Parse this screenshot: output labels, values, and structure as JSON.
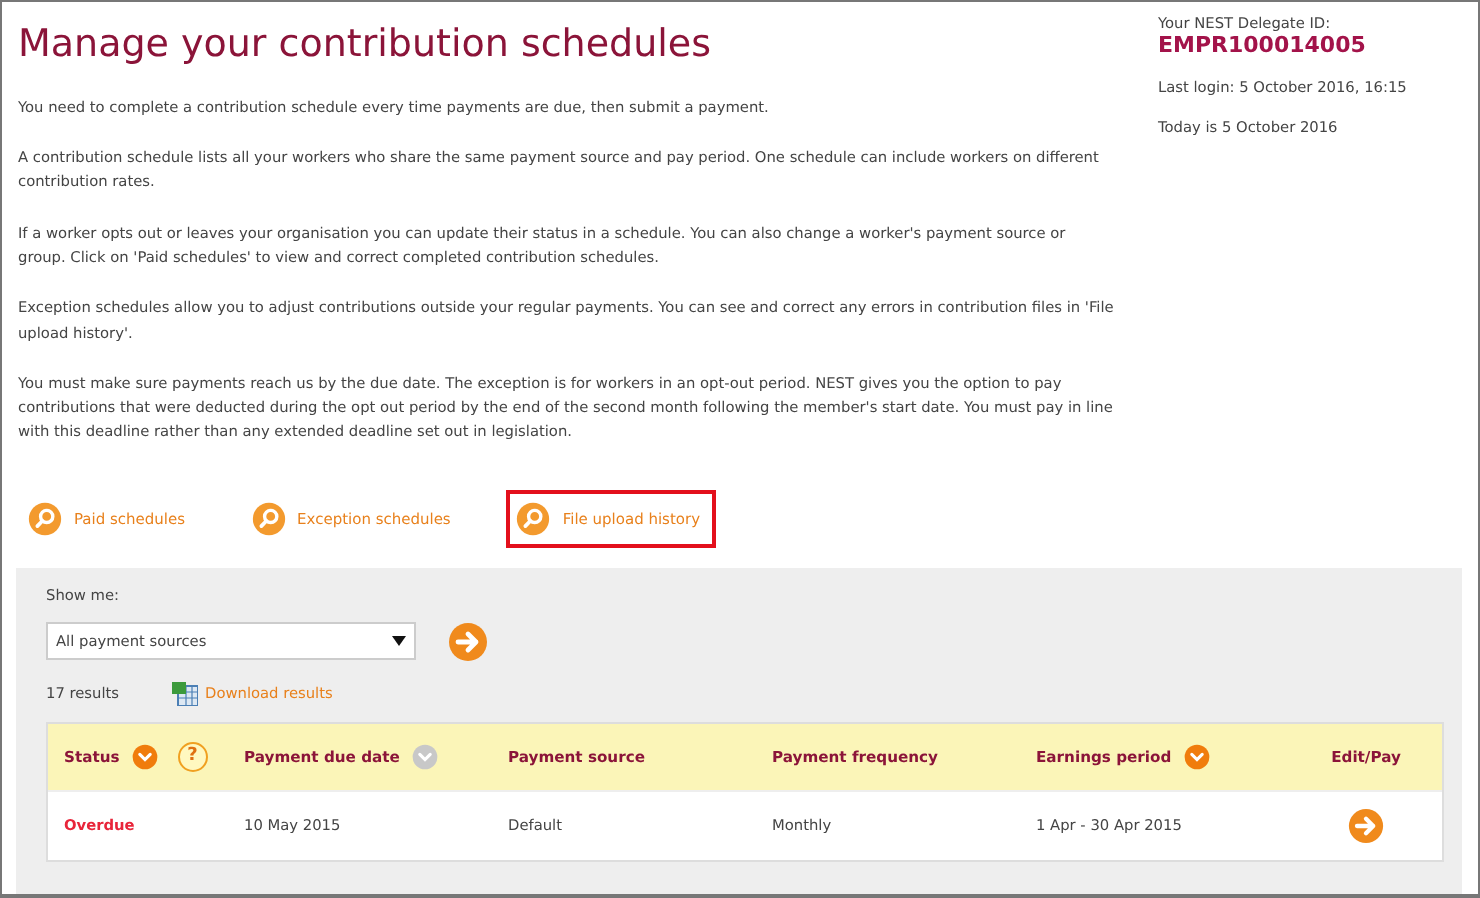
{
  "title": "Manage your contribution schedules",
  "account": {
    "id_label": "Your NEST Delegate ID:",
    "id": "EMPR100014005",
    "last_login": "Last login: 5 October 2016, 16:15",
    "today": "Today is 5 October 2016"
  },
  "paragraphs": [
    "You need to complete a contribution schedule every time payments are due, then submit a payment.",
    "A contribution schedule lists all your workers who share the same payment source and pay period. One schedule can include workers on different contribution rates.",
    "If a worker opts out or leaves your organisation you can update their status in a schedule. You can also change a worker's payment source or group. Click on 'Paid schedules' to view and correct completed contribution schedules.",
    "Exception schedules allow you to adjust contributions outside your regular payments. You can see and correct any errors in contribution files in 'File upload history'.",
    "You must make sure payments reach us by the due date. The exception is for workers in an opt-out period. NEST gives you the option to pay contributions that were deducted during the opt out period by the end of the second month following the member's start date. You must pay in line with this deadline rather than any extended deadline set out in legislation."
  ],
  "links": [
    {
      "label": "Paid schedules",
      "highlighted": false
    },
    {
      "label": "Exception schedules",
      "highlighted": false
    },
    {
      "label": "File upload history",
      "highlighted": true
    }
  ],
  "filter": {
    "label": "Show me:",
    "value": "All payment sources"
  },
  "results": {
    "count": "17 results",
    "download": "Download results"
  },
  "table": {
    "columns": [
      {
        "label": "Status",
        "sortable": true,
        "sorted": true,
        "help": "?"
      },
      {
        "label": "Payment due date",
        "sortable": true,
        "sorted": false
      },
      {
        "label": "Payment source",
        "sortable": false
      },
      {
        "label": "Payment frequency",
        "sortable": false
      },
      {
        "label": "Earnings period",
        "sortable": true,
        "sorted": true
      },
      {
        "label": "Edit/Pay",
        "sortable": false
      }
    ],
    "rows": [
      {
        "status": "Overdue",
        "due_date": "10 May 2015",
        "source": "Default",
        "frequency": "Monthly",
        "period": "1 Apr - 30 Apr 2015"
      }
    ]
  }
}
